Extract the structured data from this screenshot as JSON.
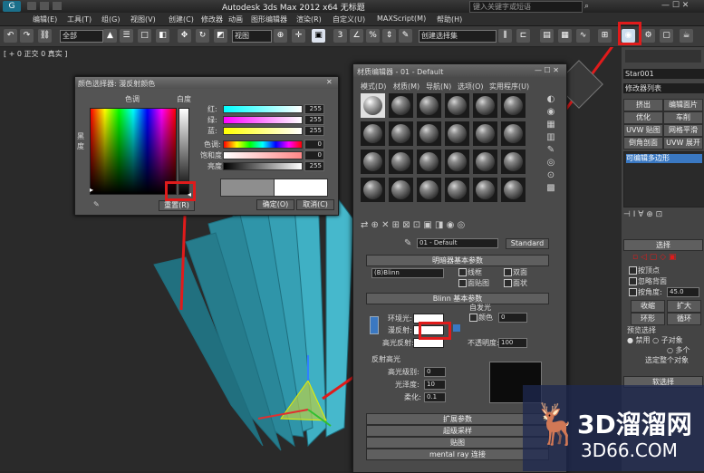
{
  "app": {
    "title": "Autodesk 3ds Max 2012 x64  无标题",
    "search_placeholder": "键入关键字或短语",
    "logo": "G"
  },
  "menu": [
    "编辑(E)",
    "工具(T)",
    "组(G)",
    "视图(V)",
    "创建(C)",
    "修改器",
    "动画",
    "图形编辑器",
    "渲染(R)",
    "自定义(U)",
    "MAXScript(M)",
    "帮助(H)"
  ],
  "toolbar": {
    "filter_select": "全部",
    "view_select": "视图",
    "named_selection": "创建选择集"
  },
  "viewport": {
    "label": "[ + 0 正交 0 真实 ]"
  },
  "color_picker": {
    "title": "颜色选择器: 漫反射颜色",
    "hue_label": "色调",
    "white_label": "白度",
    "black_label": "黑度",
    "channels": [
      {
        "label": "红:",
        "value": "255"
      },
      {
        "label": "绿:",
        "value": "255"
      },
      {
        "label": "蓝:",
        "value": "255"
      },
      {
        "label": "色调:",
        "value": "0"
      },
      {
        "label": "饱和度:",
        "value": "0"
      },
      {
        "label": "亮度:",
        "value": "255"
      }
    ],
    "reset_label": "重置(R)",
    "ok_label": "确定(O)",
    "cancel_label": "取消(C)"
  },
  "material_editor": {
    "title": "材质编辑器 - 01 - Default",
    "menu": [
      "模式(D)",
      "材质(M)",
      "导航(N)",
      "选项(O)",
      "实用程序(U)"
    ],
    "material_name": "01 - Default",
    "material_type": "Standard",
    "shader_rollout": "明暗器基本参数",
    "shader_type": "(B)Blinn",
    "shader_options": [
      "线框",
      "双面",
      "面贴图",
      "面状"
    ],
    "blinn_rollout": "Blinn 基本参数",
    "self_illum_label": "自发光",
    "color_label": "颜色",
    "self_illum_value": "0",
    "ambient_label": "环境光:",
    "diffuse_label": "漫反射:",
    "specular_label": "高光反射:",
    "opacity_label": "不透明度:",
    "opacity_value": "100",
    "spec_hl_label": "反射高光",
    "spec_level_label": "高光级别:",
    "spec_level_value": "0",
    "gloss_label": "光泽度:",
    "gloss_value": "10",
    "soften_label": "柔化:",
    "soften_value": "0.1",
    "rollouts": [
      "扩展参数",
      "超级采样",
      "贴图",
      "mental ray 连接"
    ]
  },
  "right_panel": {
    "object_name": "Star001",
    "modifier_list": "修改器列表",
    "buttons": [
      "挤出",
      "编辑面片",
      "优化",
      "车削",
      "UVW 贴图",
      "网格平滑",
      "倒角剖面",
      "UVW 展开"
    ],
    "stack_item": "可编辑多边形",
    "selection_rollout": "选择",
    "by_vertex": "按顶点",
    "ignore_backface": "忽略背面",
    "by_angle": "按角度:",
    "angle_value": "45.0",
    "shrink": "收缩",
    "grow": "扩大",
    "ring": "环形",
    "loop": "循环",
    "preview_selection": "预览选择",
    "disabled": "禁用",
    "sub_object": "子对象",
    "multi": "多个",
    "selected_whole": "选定整个对象",
    "soft_selection": "软选择"
  },
  "watermark": {
    "brand": "3D溜溜网",
    "url": "3D66.COM"
  },
  "colors": {
    "highlight": "#e01b1b",
    "object": "#3aa6b8",
    "bg": "#2a2a2a"
  }
}
